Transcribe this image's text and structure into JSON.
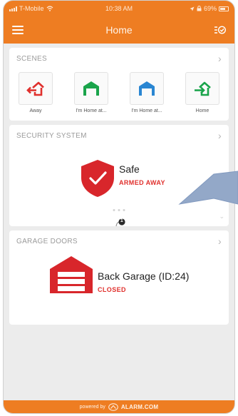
{
  "status_bar": {
    "carrier": "T-Mobile",
    "time": "10:38 AM",
    "battery": "69%"
  },
  "app_bar": {
    "title": "Home",
    "menu_icon": "hamburger-icon",
    "right_icon": "scene-list-icon"
  },
  "scenes": {
    "header": "SCENES",
    "items": [
      {
        "label": "Away",
        "icon": "leave-home-icon",
        "color": "#e0302d"
      },
      {
        "label": "I'm Home at...",
        "icon": "garage-icon",
        "color": "#1aa44b"
      },
      {
        "label": "I'm Home at...",
        "icon": "garage-icon",
        "color": "#2a86d2"
      },
      {
        "label": "Home",
        "icon": "enter-home-icon",
        "color": "#1aa44b"
      }
    ]
  },
  "security": {
    "header": "SECURITY SYSTEM",
    "name": "Safe",
    "state": "ARMED AWAY",
    "notification_count": "1"
  },
  "garage": {
    "header": "GARAGE DOORS",
    "name": "Back Garage (ID:24)",
    "state": "CLOSED"
  },
  "footer": {
    "powered_by": "powered by",
    "brand": "ALARM.COM"
  },
  "colors": {
    "brand_orange": "#ee7d22",
    "alert_red": "#e0302d",
    "callout_blue": "#93a8c8"
  }
}
